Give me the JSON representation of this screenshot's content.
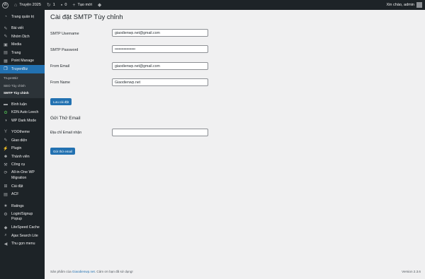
{
  "adminbar": {
    "site_name": "Truyện 2025",
    "comments_count": "1",
    "comment_bubble_count": "0",
    "new_label": "Tạo mới",
    "greeting": "Xin chào, admin"
  },
  "sidebar": {
    "items": [
      {
        "label": "Trang quản trị",
        "icon": "dashboard-icon"
      },
      {
        "label": "Bài viết",
        "icon": "pin-icon"
      },
      {
        "label": "Nhóm Dịch",
        "icon": "group-icon"
      },
      {
        "label": "Media",
        "icon": "media-icon"
      },
      {
        "label": "Trang",
        "icon": "page-icon"
      },
      {
        "label": "Point Manage",
        "icon": "point-icon"
      },
      {
        "label": "TruyenBiz",
        "icon": "book-icon"
      }
    ],
    "submenu": [
      "TruyenBiz",
      "SEO Tùy chỉnh",
      "SMTP Tùy chỉnh"
    ],
    "items2": [
      {
        "label": "Bình luận",
        "icon": "comment-icon"
      },
      {
        "label": "KDN Auto Leech",
        "icon": "leech-icon"
      },
      {
        "label": "WP Dark Mode",
        "icon": "darkmode-icon"
      }
    ],
    "items3": [
      {
        "label": "YOOtheme",
        "icon": "yootheme-icon"
      },
      {
        "label": "Giao diện",
        "icon": "appearance-icon"
      },
      {
        "label": "Plugin",
        "icon": "plugin-icon"
      },
      {
        "label": "Thành viên",
        "icon": "users-icon"
      },
      {
        "label": "Công cụ",
        "icon": "tools-icon"
      }
    ],
    "migration": {
      "line1": "All-in-One WP",
      "line2": "Migration"
    },
    "items4": [
      {
        "label": "Cài đặt",
        "icon": "settings-icon"
      },
      {
        "label": "ACF",
        "icon": "acf-icon"
      }
    ],
    "items5": [
      {
        "label": "Ratings",
        "icon": "star-icon"
      }
    ],
    "login_popup": {
      "line1": "Login/Signup",
      "line2": "Popup"
    },
    "items6": [
      {
        "label": "LiteSpeed Cache",
        "icon": "litespeed-icon"
      },
      {
        "label": "Ajax Search Lite",
        "icon": "search-icon"
      },
      {
        "label": "Thu gọn menu",
        "icon": "collapse-icon"
      }
    ]
  },
  "main": {
    "title": "Cài đặt SMTP Tùy chỉnh",
    "fields": [
      {
        "label": "SMTP Username",
        "value": "giaodienwp.net@gmail.com"
      },
      {
        "label": "SMTP Password",
        "value": "••••••••••••••••"
      },
      {
        "label": "From Email",
        "value": "giaodienwp.net@gmail.com"
      },
      {
        "label": "From Name",
        "value": "Giaodienwp.net"
      }
    ],
    "save_button": "Lưu cài đặt",
    "send_section_title": "Gửi Thử Email",
    "recipient_label": "Địa chỉ Email nhận",
    "recipient_value": "",
    "send_button": "Gửi thử email"
  },
  "footer": {
    "prefix": "Sản phẩm của ",
    "link": "Giaodienwp.net",
    "suffix": ". Cảm ơn bạn đã sử dụng!",
    "version": "Version 2.3.6"
  },
  "colors": {
    "sidebar": "#1d2327",
    "accent": "#2271b1",
    "background": "#f0f0f1"
  }
}
